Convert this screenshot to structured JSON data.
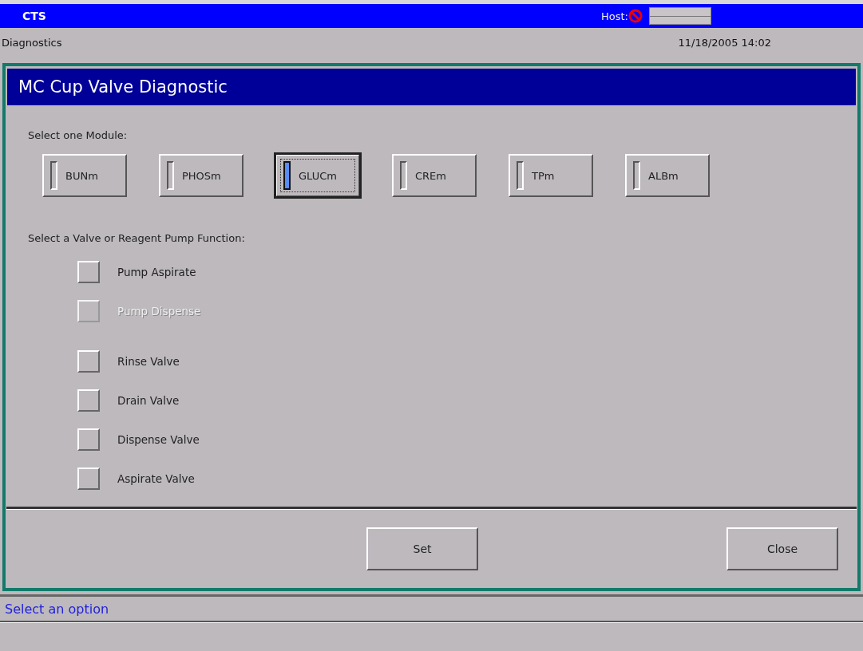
{
  "top_bar": {
    "title": "CTS",
    "host_label": "Host:",
    "host_connected": false
  },
  "header": {
    "screen": "Diagnostics",
    "datetime": "11/18/2005 14:02"
  },
  "dialog": {
    "title": "MC Cup Valve Diagnostic",
    "module_prompt": "Select one Module:",
    "modules": [
      {
        "label": "BUNm",
        "selected": false
      },
      {
        "label": "PHOSm",
        "selected": false
      },
      {
        "label": "GLUCm",
        "selected": true
      },
      {
        "label": "CREm",
        "selected": false
      },
      {
        "label": "TPm",
        "selected": false
      },
      {
        "label": "ALBm",
        "selected": false
      }
    ],
    "function_prompt": "Select a Valve or Reagent Pump Function:",
    "functions": [
      {
        "label": "Pump Aspirate",
        "checked": false,
        "disabled": false
      },
      {
        "label": "Pump Dispense",
        "checked": false,
        "disabled": true
      },
      {
        "label": "Rinse Valve",
        "checked": false,
        "disabled": false
      },
      {
        "label": "Drain Valve",
        "checked": false,
        "disabled": false
      },
      {
        "label": "Dispense Valve",
        "checked": false,
        "disabled": false
      },
      {
        "label": "Aspirate Valve",
        "checked": false,
        "disabled": false
      }
    ],
    "buttons": [
      "Set",
      "Close"
    ]
  },
  "status_bar": {
    "message": "Select an option"
  }
}
